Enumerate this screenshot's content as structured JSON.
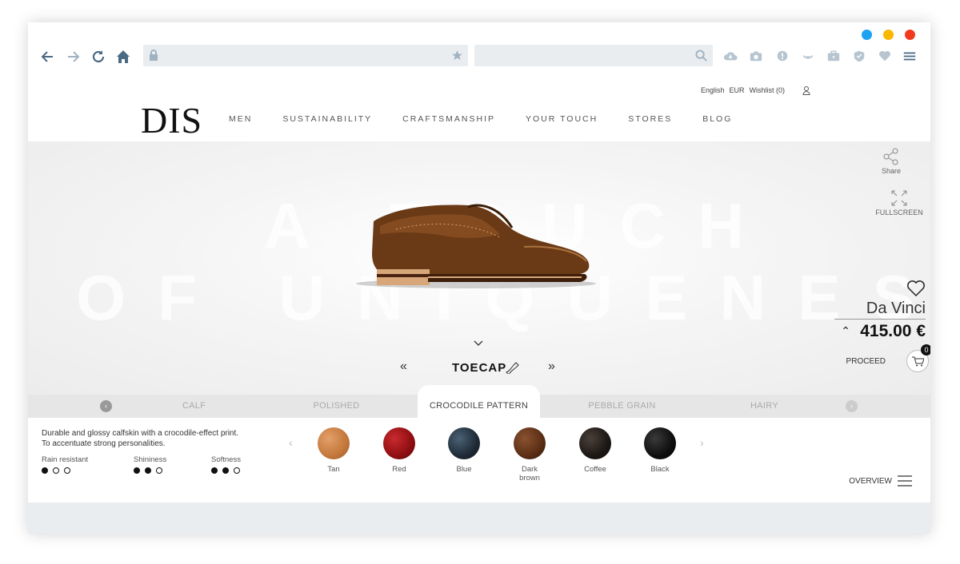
{
  "browser": {
    "window_dots": [
      "#1da1f2",
      "#f9b700",
      "#f23b1e"
    ],
    "toolbar_icons": [
      "cloud-download-icon",
      "camera-icon",
      "info-icon",
      "broadcast-icon",
      "briefcase-icon",
      "shield-icon",
      "heart-icon",
      "menu-icon"
    ]
  },
  "topbar": {
    "language": "English",
    "currency": "EUR",
    "wishlist": "Wishlist (0)"
  },
  "logo": "DIS",
  "nav": [
    "MEN",
    "SUSTAINABILITY",
    "CRAFTSMANSHIP",
    "YOUR TOUCH",
    "STORES",
    "BLOG"
  ],
  "stage": {
    "bg_line1": "A TOUCH",
    "bg_line2": "OF UNIQUENES",
    "share": "Share",
    "fullscreen": "FULLSCREEN",
    "product_name": "Da Vinci",
    "price": "415.00 €",
    "proceed": "PROCEED",
    "cart_count": "0",
    "part": "TOECAP"
  },
  "tabs": [
    {
      "label": "CALF",
      "active": false
    },
    {
      "label": "POLISHED",
      "active": false
    },
    {
      "label": "CROCODILE PATTERN",
      "active": true
    },
    {
      "label": "PEBBLE GRAIN",
      "active": false
    },
    {
      "label": "HAIRY",
      "active": false
    }
  ],
  "description": {
    "line1": "Durable and glossy calfskin with a crocodile-effect print.",
    "line2": "To accentuate strong personalities."
  },
  "properties": [
    {
      "label": "Rain resistant",
      "level": 1,
      "max": 3
    },
    {
      "label": "Shininess",
      "level": 2,
      "max": 3
    },
    {
      "label": "Softness",
      "level": 2,
      "max": 3
    }
  ],
  "swatches": [
    {
      "label": "Tan",
      "color": "#c4773a"
    },
    {
      "label": "Red",
      "color": "#8e0e12"
    },
    {
      "label": "Blue",
      "color": "#1f2a36"
    },
    {
      "label": "Dark brown",
      "color": "#5a2e15"
    },
    {
      "label": "Coffee",
      "color": "#1c1714"
    },
    {
      "label": "Black",
      "color": "#0e0e0e"
    }
  ],
  "overview": "OVERVIEW"
}
